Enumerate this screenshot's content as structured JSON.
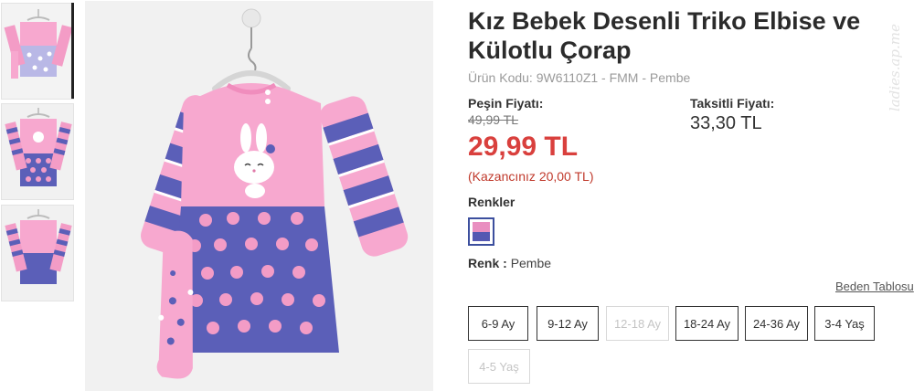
{
  "product": {
    "title": "Kız Bebek Desenli Triko Elbise ve Külotlu Çorap",
    "code_line": "Ürün Kodu: 9W6110Z1 - FMM - Pembe"
  },
  "pricing": {
    "cash_label": "Peşin Fiyatı:",
    "old_price": "49,99 TL",
    "new_price": "29,99 TL",
    "saving": "(Kazancınız 20,00 TL)",
    "installment_label": "Taksitli Fiyatı:",
    "installment_price": "33,30 TL"
  },
  "colors": {
    "label": "Renkler",
    "selected_label": "Renk :",
    "selected_value": "Pembe",
    "swatch_top": "#e98fc0",
    "swatch_bottom": "#5458b2"
  },
  "size_table_link": "Beden Tablosu",
  "sizes": [
    {
      "label": "6-9 Ay",
      "available": true
    },
    {
      "label": "9-12 Ay",
      "available": true
    },
    {
      "label": "12-18 Ay",
      "available": false
    },
    {
      "label": "18-24 Ay",
      "available": true
    },
    {
      "label": "24-36 Ay",
      "available": true
    },
    {
      "label": "3-4 Yaş",
      "available": true
    },
    {
      "label": "4-5 Yaş",
      "available": false
    }
  ],
  "watermark": "ladies.ap.me",
  "theme": {
    "price_red": "#d9403d",
    "dress_pink": "#f39cc6",
    "dress_blue": "#5b5fb8",
    "background_gray": "#f1f1f1"
  }
}
